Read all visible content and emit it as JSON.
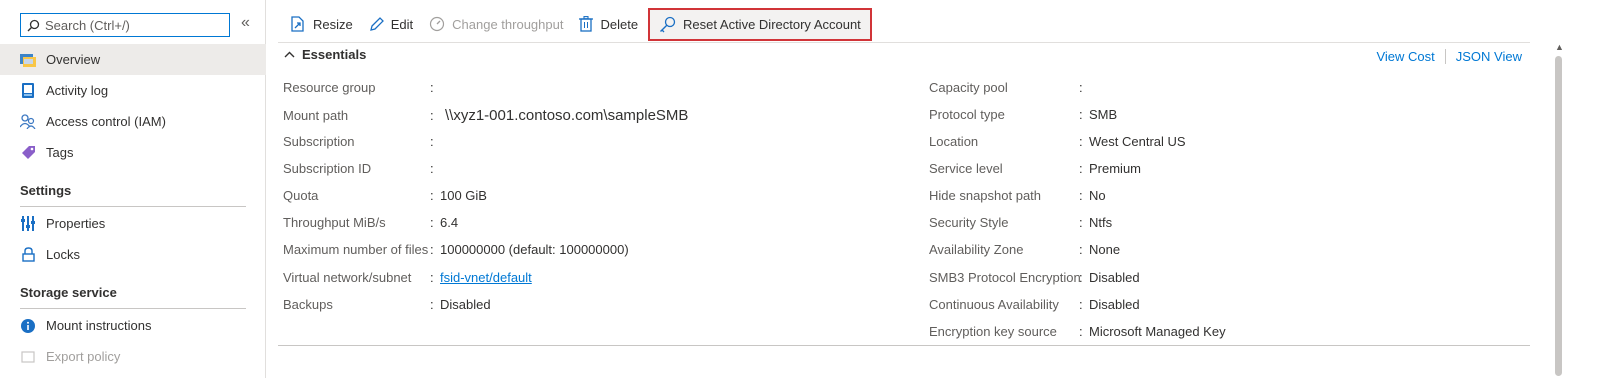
{
  "search": {
    "placeholder": "Search (Ctrl+/)"
  },
  "sidebar": {
    "collapse_icon": "«",
    "items": [
      {
        "label": "Overview",
        "icon": "overview-icon"
      },
      {
        "label": "Activity log",
        "icon": "activity-log-icon"
      },
      {
        "label": "Access control (IAM)",
        "icon": "iam-icon"
      },
      {
        "label": "Tags",
        "icon": "tag-icon"
      }
    ],
    "settings_header": "Settings",
    "settings_items": [
      {
        "label": "Properties",
        "icon": "properties-icon"
      },
      {
        "label": "Locks",
        "icon": "lock-icon"
      }
    ],
    "storage_header": "Storage service",
    "storage_items": [
      {
        "label": "Mount instructions",
        "icon": "info-icon"
      },
      {
        "label": "Export policy",
        "icon": "export-policy-icon"
      }
    ]
  },
  "toolbar": {
    "resize": "Resize",
    "edit": "Edit",
    "change_throughput": "Change throughput",
    "delete": "Delete",
    "reset_ad": "Reset Active Directory Account"
  },
  "essentials": {
    "title": "Essentials",
    "view_cost": "View Cost",
    "json_view": "JSON View",
    "left": [
      {
        "label": "Resource group",
        "value": ""
      },
      {
        "label": "Mount path",
        "value": "\\\\xyz1-001.contoso.com\\sampleSMB"
      },
      {
        "label": "Subscription",
        "value": ""
      },
      {
        "label": "Subscription ID",
        "value": ""
      },
      {
        "label": "Quota",
        "value": "100 GiB"
      },
      {
        "label": "Throughput MiB/s",
        "value": "6.4"
      },
      {
        "label": "Maximum number of files",
        "value": "100000000 (default: 100000000)"
      },
      {
        "label": "Virtual network/subnet",
        "value": "fsid-vnet/default"
      },
      {
        "label": "Backups",
        "value": "Disabled"
      }
    ],
    "right": [
      {
        "label": "Capacity pool",
        "value": ""
      },
      {
        "label": "Protocol type",
        "value": "SMB"
      },
      {
        "label": "Location",
        "value": "West Central US"
      },
      {
        "label": "Service level",
        "value": "Premium"
      },
      {
        "label": "Hide snapshot path",
        "value": "No"
      },
      {
        "label": "Security Style",
        "value": "Ntfs"
      },
      {
        "label": "Availability Zone",
        "value": "None"
      },
      {
        "label": "SMB3 Protocol Encryption",
        "value": "Disabled"
      },
      {
        "label": "Continuous Availability",
        "value": "Disabled"
      },
      {
        "label": "Encryption key source",
        "value": "Microsoft Managed Key"
      }
    ],
    "colon": ":"
  },
  "colors": {
    "accent": "#0078d4",
    "highlight_border": "#d13438"
  }
}
